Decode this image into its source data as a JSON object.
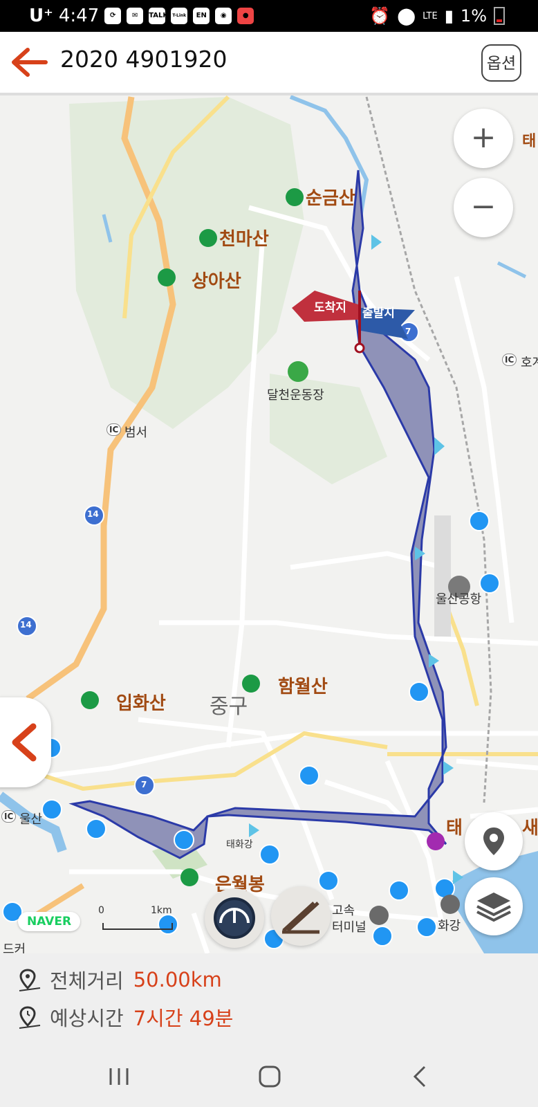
{
  "status_bar": {
    "carrier": "U⁺",
    "time": "4:47",
    "notif_talk": "TALK",
    "notif_tlink": "T-Link",
    "notif_en": "EN",
    "network": "LTE",
    "battery": "1%"
  },
  "header": {
    "title": "2020 4901920",
    "option_label": "옵션"
  },
  "map": {
    "mountains": [
      "순금산",
      "천마산",
      "상아산",
      "함월산",
      "입화산",
      "은월봉"
    ],
    "pois": [
      "달천운동장",
      "울산공항",
      "범서",
      "울산",
      "호계",
      "고속",
      "터미널",
      "화강",
      "태화강"
    ],
    "district": "중구",
    "flag_end": "도착지",
    "flag_start": "출발지",
    "road_numbers": [
      "14",
      "14",
      "7",
      "7"
    ],
    "ic_label": "IC",
    "partial_labels": [
      "태",
      "새",
      "태",
      "드커"
    ],
    "scale_start": "0",
    "scale_end": "1km",
    "naver_logo": "NAVER",
    "route_color": "#2b3aa8"
  },
  "controls": {
    "zoom_in": "+",
    "zoom_out": "−"
  },
  "summary": {
    "distance_label": "전체거리",
    "distance_value": "50.00km",
    "time_label": "예상시간",
    "time_value": "7시간 49분"
  }
}
